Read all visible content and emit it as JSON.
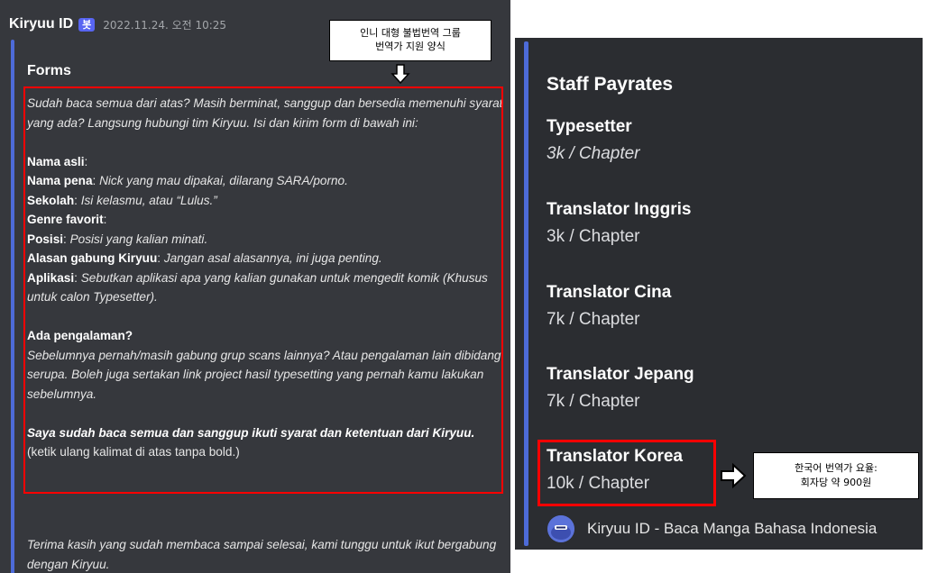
{
  "left": {
    "author": "Kiryuu ID",
    "bot_badge": "봇",
    "timestamp": "2022.11.24. 오전 10:25",
    "callout": [
      "인니 대형 불법번역 그룹",
      "번역가 지원 양식"
    ],
    "embed_title": "Forms",
    "body": {
      "intro": "Sudah baca semua dari atas? Masih berminat, sanggup dan bersedia memenuhi syarat yang ada? Langsung hubungi tim Kiryuu. Isi dan kirim form di bawah ini:",
      "nama_asli_label": "Nama asli",
      "nama_asli_value": ":",
      "nama_pena_label": "Nama pena",
      "nama_pena_value": "Nick yang mau dipakai, dilarang SARA/porno.",
      "sekolah_label": "Sekolah",
      "sekolah_value": "Isi kelasmu, atau “Lulus.”",
      "genre_label": "Genre favorit",
      "genre_value": ":",
      "posisi_label": "Posisi",
      "posisi_value": "Posisi yang kalian minati.",
      "alasan_label": "Alasan gabung Kiryuu",
      "alasan_value": "Jangan asal alasannya, ini juga penting.",
      "aplikasi_label": "Aplikasi",
      "aplikasi_value": "Sebutkan aplikasi apa yang kalian gunakan untuk mengedit komik (Khusus untuk calon Typesetter).",
      "pengalaman_label": "Ada pengalaman?",
      "pengalaman_value": "Sebelumnya pernah/masih gabung grup scans lainnya? Atau pengalaman lain dibidang serupa. Boleh juga sertakan link project hasil typesetting yang pernah kamu lakukan sebelumnya.",
      "confirm_text": "Saya sudah baca semua dan sanggup ikuti syarat dan ketentuan dari Kiryuu.",
      "confirm_note": "(ketik ulang kalimat di atas tanpa bold.)"
    },
    "footer": "Terima kasih yang sudah membaca sampai selesai, kami tunggu untuk ikut bergabung dengan Kiryuu."
  },
  "right": {
    "title": "Staff Payrates",
    "roles": [
      {
        "name": "Typesetter",
        "rate": "3k / Chapter"
      },
      {
        "name": "Translator Inggris",
        "rate": "3k / Chapter"
      },
      {
        "name": "Translator Cina",
        "rate": "7k / Chapter"
      },
      {
        "name": "Translator Jepang",
        "rate": "7k / Chapter"
      },
      {
        "name": "Translator Korea",
        "rate": "10k / Chapter"
      }
    ],
    "footer": "Kiryuu ID - Baca Manga Bahasa Indonesia",
    "callout": [
      "한국어 번역가 요율:",
      "회자당 약 900원"
    ]
  },
  "colors": {
    "left_bg": "#36383d",
    "right_bg": "#2b2d31",
    "embed_bar": "#4d6bd8",
    "highlight": "#ff0000",
    "badge": "#5865f2"
  }
}
